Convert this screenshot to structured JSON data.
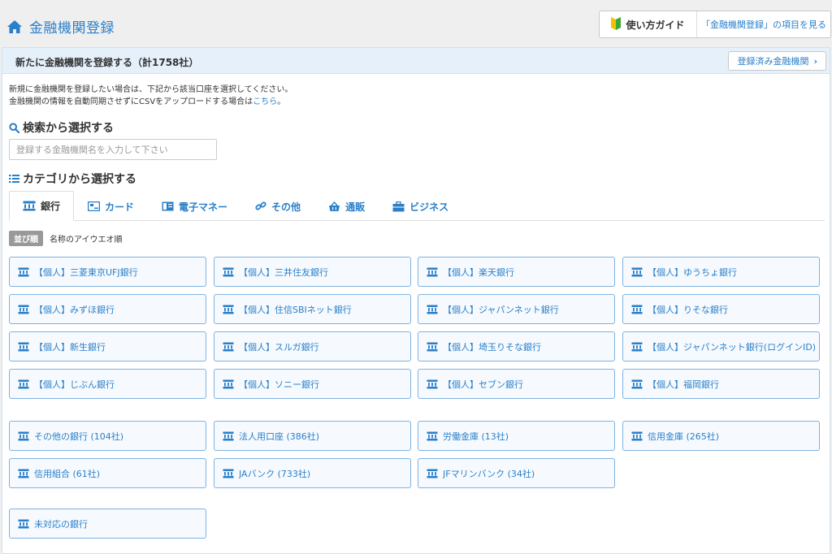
{
  "header": {
    "title": "金融機関登録",
    "guide_label": "使い方ガイド",
    "guide_link": "「金融機関登録」の項目を見る"
  },
  "panel": {
    "title": "新たに金融機関を登録する（計1758社）",
    "registered_button": "登録済み金融機関",
    "intro_line1": "新規に金融機関を登録したい場合は、下記から該当口座を選択してください。",
    "intro_line2_prefix": "金融機関の情報を自動同期させずにCSVをアップロードする場合は",
    "intro_line2_link": "こちら",
    "intro_line2_suffix": "。"
  },
  "search": {
    "title": "検索から選択する",
    "placeholder": "登録する金融機関名を入力して下さい",
    "value": ""
  },
  "category": {
    "title": "カテゴリから選択する",
    "tabs": [
      {
        "label": "銀行",
        "icon": "bank-icon",
        "active": true
      },
      {
        "label": "カード",
        "icon": "card-icon",
        "active": false
      },
      {
        "label": "電子マネー",
        "icon": "emoney-icon",
        "active": false
      },
      {
        "label": "その他",
        "icon": "link-icon",
        "active": false
      },
      {
        "label": "通販",
        "icon": "basket-icon",
        "active": false
      },
      {
        "label": "ビジネス",
        "icon": "briefcase-icon",
        "active": false
      }
    ]
  },
  "sort": {
    "badge": "並び順",
    "label": "名称のアイウエオ順"
  },
  "banks": [
    "【個人】三菱東京UFJ銀行",
    "【個人】三井住友銀行",
    "【個人】楽天銀行",
    "【個人】ゆうちょ銀行",
    "【個人】みずほ銀行",
    "【個人】住信SBIネット銀行",
    "【個人】ジャパンネット銀行",
    "【個人】りそな銀行",
    "【個人】新生銀行",
    "【個人】スルガ銀行",
    "【個人】埼玉りそな銀行",
    "【個人】ジャパンネット銀行(ログインID)",
    "【個人】じぶん銀行",
    "【個人】ソニー銀行",
    "【個人】セブン銀行",
    "【個人】福岡銀行"
  ],
  "groups": [
    "その他の銀行 (104社)",
    "法人用口座 (386社)",
    "労働金庫 (13社)",
    "信用金庫 (265社)",
    "信用組合 (61社)",
    "JAバンク (733社)",
    "JFマリンバンク (34社)"
  ],
  "unsupported": "未対応の銀行",
  "colors": {
    "accent": "#2a7fc9",
    "panel_header_bg": "#e6f0fa",
    "button_border": "#7fb2e0"
  }
}
